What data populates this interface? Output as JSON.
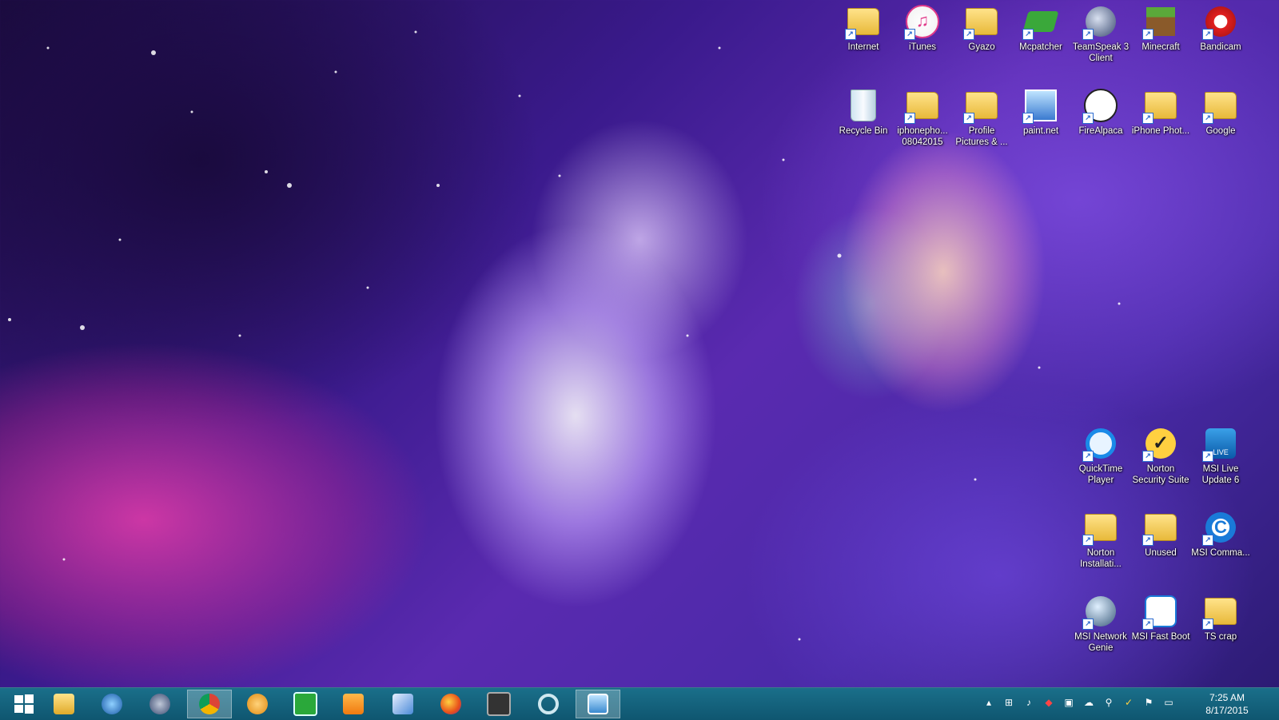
{
  "desktop_icons": [
    {
      "label": "Internet",
      "icon": "folder-icon"
    },
    {
      "label": "iTunes",
      "icon": "itunes-icon"
    },
    {
      "label": "Gyazo",
      "icon": "folder-icon"
    },
    {
      "label": "Mcpatcher",
      "icon": "mcpatcher-icon"
    },
    {
      "label": "TeamSpeak 3 Client",
      "icon": "teamspeak-icon"
    },
    {
      "label": "Minecraft",
      "icon": "minecraft-icon"
    },
    {
      "label": "Bandicam",
      "icon": "bandicam-icon"
    },
    {
      "label": "Recycle Bin",
      "icon": "recycle-bin-icon"
    },
    {
      "label": "iphonepho... 08042015",
      "icon": "folder-icon"
    },
    {
      "label": "Profile Pictures & ...",
      "icon": "folder-icon"
    },
    {
      "label": "paint.net",
      "icon": "paintnet-icon"
    },
    {
      "label": "FireAlpaca",
      "icon": "firealpaca-icon"
    },
    {
      "label": "iPhone Phot...",
      "icon": "folder-icon"
    },
    {
      "label": "Google",
      "icon": "folder-icon"
    },
    {
      "label": "QuickTime Player",
      "icon": "quicktime-icon"
    },
    {
      "label": "Norton Security Suite",
      "icon": "norton-icon"
    },
    {
      "label": "MSI Live Update 6",
      "icon": "msi-live-update-icon"
    },
    {
      "label": "Norton Installati...",
      "icon": "folder-icon"
    },
    {
      "label": "Unused",
      "icon": "folder-icon"
    },
    {
      "label": "MSI Comma...",
      "icon": "msi-command-icon"
    },
    {
      "label": "MSI Network Genie",
      "icon": "msi-network-icon"
    },
    {
      "label": "MSI Fast Boot",
      "icon": "msi-fastboot-icon"
    },
    {
      "label": "TS crap",
      "icon": "folder-icon"
    }
  ],
  "taskbar": {
    "items": [
      {
        "icon": "windows-start-icon"
      },
      {
        "icon": "file-explorer-icon"
      },
      {
        "icon": "thunderbird-icon"
      },
      {
        "icon": "teamspeak-icon"
      },
      {
        "icon": "chrome-icon"
      },
      {
        "icon": "trillian-icon"
      },
      {
        "icon": "calculator-icon"
      },
      {
        "icon": "media-player-icon"
      },
      {
        "icon": "notepad-icon"
      },
      {
        "icon": "firefox-icon"
      },
      {
        "icon": "movie-maker-icon"
      },
      {
        "icon": "circle-app-icon"
      },
      {
        "icon": "photo-viewer-icon"
      }
    ],
    "clock": {
      "time": "7:25 AM",
      "date": "8/17/2015"
    }
  },
  "colors": {
    "taskbar": "#1a6f8a",
    "accent": "#2a6ad0"
  }
}
